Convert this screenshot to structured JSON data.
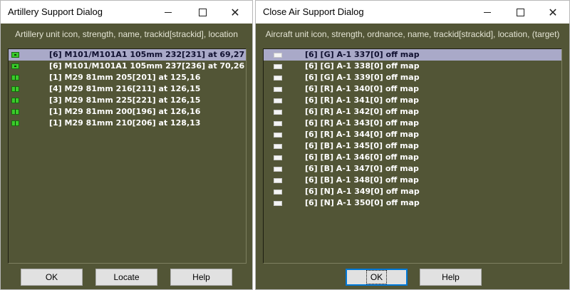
{
  "artillery_dialog": {
    "title": "Artillery Support Dialog",
    "title_buttons": {
      "minimize": "",
      "maximize": "",
      "close": "✕"
    },
    "header": "Artillery unit icon, strength, name, trackid[strackid], location",
    "rows": [
      {
        "text": "[6] M101/M101A1 105mm 232[231] at 69,27",
        "icon": "howitzer-unit-icon",
        "selected": true
      },
      {
        "text": "[6] M101/M101A1 105mm 237[236] at 70,26",
        "icon": "howitzer-unit-icon",
        "selected": false
      },
      {
        "text": "[1] M29 81mm 205[201] at 125,16",
        "icon": "mortar-unit-icon",
        "selected": false
      },
      {
        "text": "[4] M29 81mm 216[211] at 126,15",
        "icon": "mortar-unit-icon",
        "selected": false
      },
      {
        "text": "[3] M29 81mm 225[221] at 126,15",
        "icon": "mortar-unit-icon",
        "selected": false
      },
      {
        "text": "[1] M29 81mm 200[196] at 126,16",
        "icon": "mortar-unit-icon",
        "selected": false
      },
      {
        "text": "[1] M29 81mm 210[206] at 128,13",
        "icon": "mortar-unit-icon",
        "selected": false
      }
    ],
    "buttons": {
      "ok": "OK",
      "locate": "Locate",
      "help": "Help"
    }
  },
  "cas_dialog": {
    "title": "Close Air Support Dialog",
    "title_buttons": {
      "minimize": "",
      "maximize": "",
      "close": "✕"
    },
    "header": "Aircraft unit icon, strength, ordnance, name, trackid[strackid], location, (target)",
    "rows": [
      {
        "text": "[6] [G] A-1 337[0] off map",
        "selected": true
      },
      {
        "text": "[6] [G] A-1 338[0] off map",
        "selected": false
      },
      {
        "text": "[6] [G] A-1 339[0] off map",
        "selected": false
      },
      {
        "text": "[6] [R] A-1 340[0] off map",
        "selected": false
      },
      {
        "text": "[6] [R] A-1 341[0] off map",
        "selected": false
      },
      {
        "text": "[6] [R] A-1 342[0] off map",
        "selected": false
      },
      {
        "text": "[6] [R] A-1 343[0] off map",
        "selected": false
      },
      {
        "text": "[6] [R] A-1 344[0] off map",
        "selected": false
      },
      {
        "text": "[6] [B] A-1 345[0] off map",
        "selected": false
      },
      {
        "text": "[6] [B] A-1 346[0] off map",
        "selected": false
      },
      {
        "text": "[6] [B] A-1 347[0] off map",
        "selected": false
      },
      {
        "text": "[6] [B] A-1 348[0] off map",
        "selected": false
      },
      {
        "text": "[6] [N] A-1 349[0] off map",
        "selected": false
      },
      {
        "text": "[6] [N] A-1 350[0] off map",
        "selected": false
      }
    ],
    "buttons": {
      "ok": "OK",
      "help": "Help"
    }
  },
  "colors": {
    "client_bg": "#525536",
    "list_text": "#ffffff",
    "selection_bg": "#a9a9c8",
    "unit_icon_green": "#3acb2a",
    "aircraft_icon": "#f4f4f4"
  }
}
